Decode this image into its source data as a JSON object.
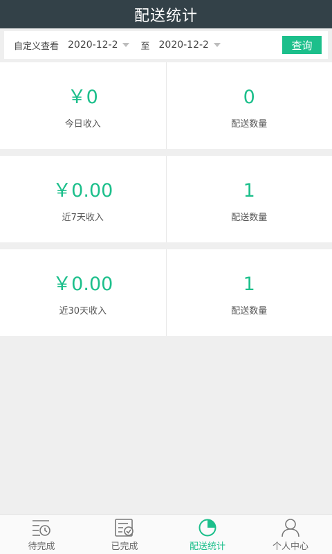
{
  "header": {
    "title": "配送统计"
  },
  "filter": {
    "label": "自定义查看",
    "start_date": "2020-12-2",
    "separator": "至",
    "end_date": "2020-12-2",
    "query_button": "查询"
  },
  "stats": [
    {
      "income_value": "￥0",
      "income_label": "今日收入",
      "count_value": "0",
      "count_label": "配送数量"
    },
    {
      "income_value": "￥0.00",
      "income_label": "近7天收入",
      "count_value": "1",
      "count_label": "配送数量"
    },
    {
      "income_value": "￥0.00",
      "income_label": "近30天收入",
      "count_value": "1",
      "count_label": "配送数量"
    }
  ],
  "tabs": [
    {
      "label": "待完成",
      "icon": "pending-list-icon",
      "active": false
    },
    {
      "label": "已完成",
      "icon": "completed-doc-icon",
      "active": false
    },
    {
      "label": "配送统计",
      "icon": "pie-chart-icon",
      "active": true
    },
    {
      "label": "个人中心",
      "icon": "person-icon",
      "active": false
    }
  ],
  "colors": {
    "accent": "#1cbf8b",
    "header_bg": "#334148",
    "page_bg": "#efefef"
  }
}
